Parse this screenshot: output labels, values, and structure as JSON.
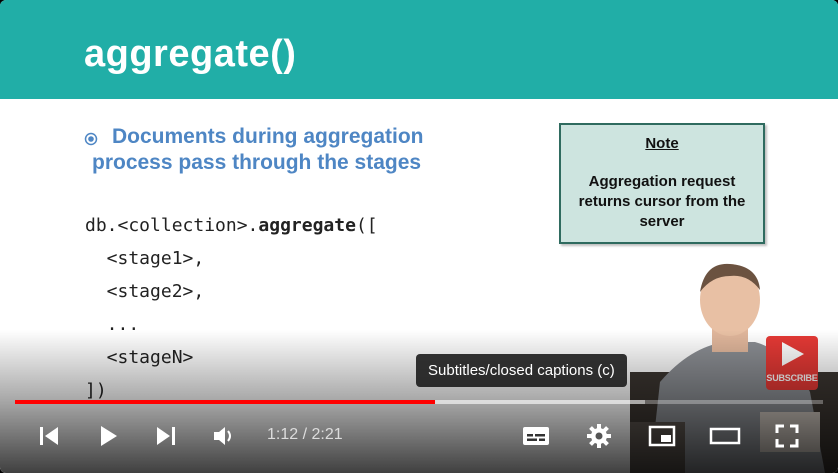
{
  "slide": {
    "title": "aggregate()",
    "bullet": "Documents during aggregation process pass through the stages",
    "code": {
      "line1_prefix": "db.<collection>.",
      "line1_keyword": "aggregate",
      "line1_suffix": "([",
      "line2": "  <stage1>,",
      "line3": "  <stage2>,",
      "line4": "  ...",
      "line5": "  <stageN>",
      "line6": "])"
    },
    "note": {
      "title": "Note",
      "text": "Aggregation request returns cursor from the server"
    },
    "colors": {
      "header": "#21aea7",
      "bullet": "#4e86c4",
      "note_bg": "#cde4df"
    }
  },
  "subscribe_watermark": "SUBSCRIBE",
  "player": {
    "tooltip": "Subtitles/closed captions (c)",
    "time": "1:12 / 2:21",
    "progress_played_fraction": 0.52,
    "progress_buffered_fraction": 0.78,
    "progress_color": "#ff0000",
    "controls": {
      "prev_icon": "skip-previous-icon",
      "play_icon": "play-icon",
      "next_icon": "skip-next-icon",
      "volume_icon": "volume-icon",
      "subtitles_icon": "subtitles-icon",
      "settings_icon": "settings-gear-icon",
      "miniplayer_icon": "miniplayer-icon",
      "theater_icon": "theater-mode-icon",
      "fullscreen_icon": "fullscreen-icon"
    }
  }
}
